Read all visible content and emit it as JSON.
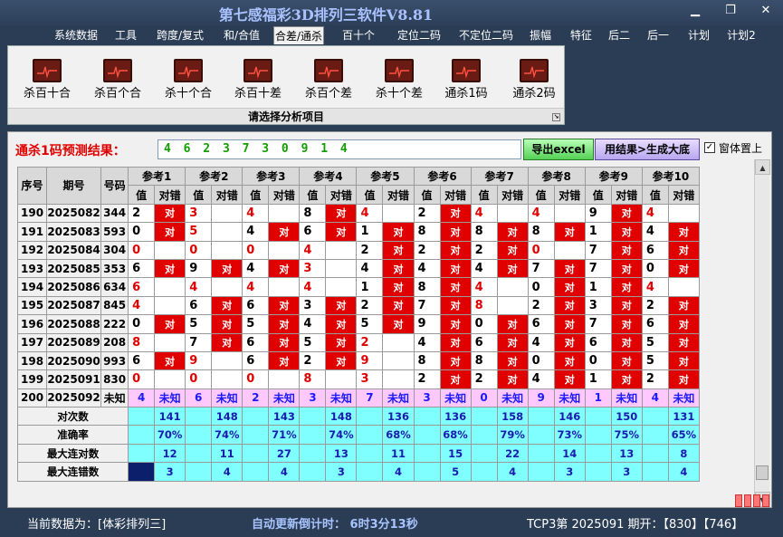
{
  "window": {
    "title": "第七感福彩3D排列三软件V8.81"
  },
  "menu": [
    "系统数据",
    "工具",
    "跨度/复式",
    "和/合值",
    "合差/通杀",
    "百十个",
    "定位二码",
    "不定位二码",
    "振幅",
    "特征",
    "后二",
    "后一",
    "计划",
    "计划2"
  ],
  "menu_active_index": 4,
  "ribbon": {
    "tools": [
      "杀百十合",
      "杀百个合",
      "杀十个合",
      "杀百十差",
      "杀百个差",
      "杀十个差",
      "通杀1码",
      "通杀2码"
    ],
    "caption": "请选择分析项目"
  },
  "result": {
    "label": "通杀1码预测结果：",
    "value": "4 6 2 3 7 3 0 9 1 4",
    "export_button": "导出excel",
    "generate_button": "用结果>生成大底",
    "pin_label": "窗体置上",
    "pin_checked": true
  },
  "table": {
    "head_main": [
      "序号",
      "期号",
      "号码"
    ],
    "ref_groups": [
      "参考1",
      "参考2",
      "参考3",
      "参考4",
      "参考5",
      "参考6",
      "参考7",
      "参考8",
      "参考9",
      "参考10"
    ],
    "sub_val": "值",
    "sub_mark": "对错",
    "hit_label": "对",
    "rows": [
      {
        "seq": "190",
        "issue": "2025082",
        "code": "344",
        "vals": [
          "2",
          "3",
          "4",
          "8",
          "4",
          "2",
          "4",
          "4",
          "9",
          "4"
        ],
        "hit": [
          1,
          0,
          0,
          1,
          0,
          1,
          0,
          0,
          1,
          0
        ],
        "hi": [
          0,
          1,
          1,
          0,
          1,
          0,
          1,
          1,
          0,
          1
        ]
      },
      {
        "seq": "191",
        "issue": "2025083",
        "code": "593",
        "vals": [
          "0",
          "5",
          "4",
          "6",
          "1",
          "8",
          "8",
          "8",
          "1",
          "4"
        ],
        "hit": [
          1,
          0,
          1,
          1,
          1,
          1,
          1,
          1,
          1,
          1
        ],
        "hi": [
          0,
          1,
          0,
          0,
          0,
          0,
          0,
          0,
          0,
          0
        ]
      },
      {
        "seq": "192",
        "issue": "2025084",
        "code": "304",
        "vals": [
          "0",
          "0",
          "0",
          "4",
          "2",
          "2",
          "2",
          "0",
          "7",
          "6"
        ],
        "hit": [
          0,
          0,
          0,
          0,
          1,
          1,
          1,
          0,
          1,
          1
        ],
        "hi": [
          1,
          1,
          1,
          1,
          0,
          0,
          0,
          1,
          0,
          0
        ]
      },
      {
        "seq": "193",
        "issue": "2025085",
        "code": "353",
        "vals": [
          "6",
          "9",
          "4",
          "3",
          "4",
          "4",
          "4",
          "7",
          "7",
          "0"
        ],
        "hit": [
          1,
          1,
          1,
          0,
          1,
          1,
          1,
          1,
          1,
          1
        ],
        "hi": [
          0,
          0,
          0,
          1,
          0,
          0,
          0,
          0,
          0,
          0
        ]
      },
      {
        "seq": "194",
        "issue": "2025086",
        "code": "634",
        "vals": [
          "6",
          "4",
          "4",
          "4",
          "1",
          "8",
          "4",
          "0",
          "1",
          "4"
        ],
        "hit": [
          0,
          0,
          0,
          0,
          1,
          1,
          0,
          1,
          1,
          0
        ],
        "hi": [
          1,
          1,
          1,
          1,
          0,
          0,
          1,
          0,
          0,
          1
        ]
      },
      {
        "seq": "195",
        "issue": "2025087",
        "code": "845",
        "vals": [
          "4",
          "6",
          "6",
          "3",
          "2",
          "7",
          "8",
          "2",
          "3",
          "2"
        ],
        "hit": [
          0,
          1,
          1,
          1,
          1,
          1,
          0,
          1,
          1,
          1
        ],
        "hi": [
          1,
          0,
          0,
          0,
          0,
          0,
          1,
          0,
          0,
          0
        ]
      },
      {
        "seq": "196",
        "issue": "2025088",
        "code": "222",
        "vals": [
          "0",
          "5",
          "5",
          "4",
          "5",
          "9",
          "0",
          "6",
          "7",
          "6"
        ],
        "hit": [
          1,
          1,
          1,
          1,
          1,
          1,
          1,
          1,
          1,
          1
        ],
        "hi": [
          0,
          0,
          0,
          0,
          0,
          0,
          0,
          0,
          0,
          0
        ]
      },
      {
        "seq": "197",
        "issue": "2025089",
        "code": "208",
        "vals": [
          "8",
          "7",
          "6",
          "5",
          "2",
          "4",
          "6",
          "4",
          "6",
          "5"
        ],
        "hit": [
          0,
          1,
          1,
          1,
          0,
          1,
          1,
          1,
          1,
          1
        ],
        "hi": [
          1,
          0,
          0,
          0,
          1,
          0,
          0,
          0,
          0,
          0
        ]
      },
      {
        "seq": "198",
        "issue": "2025090",
        "code": "993",
        "vals": [
          "6",
          "9",
          "6",
          "2",
          "9",
          "8",
          "8",
          "0",
          "0",
          "5"
        ],
        "hit": [
          1,
          0,
          1,
          1,
          0,
          1,
          1,
          1,
          1,
          1
        ],
        "hi": [
          0,
          1,
          0,
          0,
          1,
          0,
          0,
          0,
          0,
          0
        ]
      },
      {
        "seq": "199",
        "issue": "2025091",
        "code": "830",
        "vals": [
          "0",
          "0",
          "0",
          "8",
          "3",
          "2",
          "2",
          "4",
          "1",
          "2"
        ],
        "hit": [
          0,
          0,
          0,
          0,
          0,
          1,
          1,
          1,
          1,
          1
        ],
        "hi": [
          1,
          1,
          1,
          1,
          1,
          0,
          0,
          0,
          0,
          0
        ]
      }
    ],
    "pred": {
      "seq": "200",
      "issue": "2025092",
      "code": "未知",
      "vals": [
        "4",
        "6",
        "2",
        "3",
        "7",
        "3",
        "0",
        "9",
        "1",
        "4"
      ],
      "mark": "未知"
    },
    "stats": [
      {
        "label": "对次数",
        "values": [
          "141",
          "148",
          "143",
          "148",
          "136",
          "136",
          "158",
          "146",
          "150",
          "131"
        ]
      },
      {
        "label": "准确率",
        "values": [
          "70%",
          "74%",
          "71%",
          "74%",
          "68%",
          "68%",
          "79%",
          "73%",
          "75%",
          "65%"
        ]
      },
      {
        "label": "最大连对数",
        "values": [
          "12",
          "11",
          "27",
          "13",
          "11",
          "15",
          "22",
          "14",
          "13",
          "8"
        ]
      },
      {
        "label": "最大连错数",
        "values": [
          "3",
          "4",
          "4",
          "3",
          "4",
          "5",
          "4",
          "3",
          "3",
          "4"
        ]
      }
    ]
  },
  "status": {
    "current_data": "当前数据为：[体彩排列三]",
    "countdown": "自动更新倒计时： 6时3分13秒",
    "issue_info": "TCP3第 2025091 期开：【830】【746】"
  }
}
